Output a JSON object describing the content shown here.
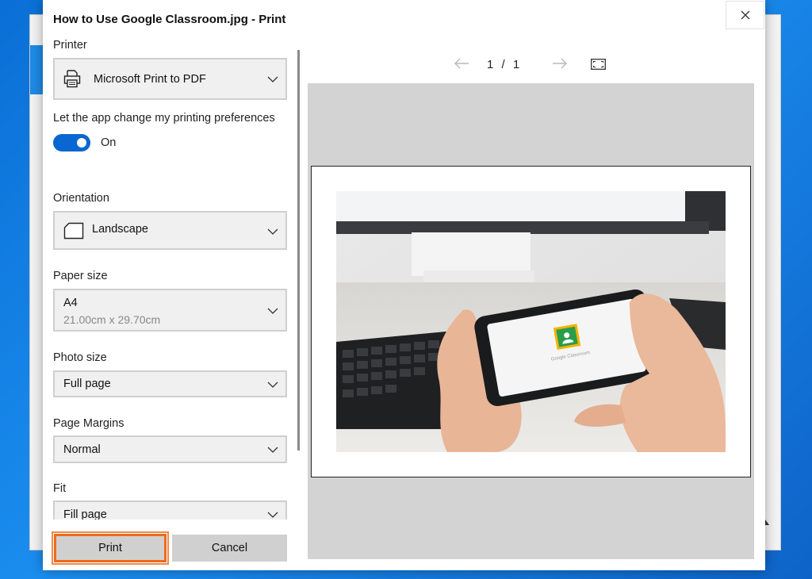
{
  "dialog": {
    "title": "How to Use Google Classroom.jpg - Print",
    "close_icon": "close-icon"
  },
  "printer": {
    "label": "Printer",
    "value": "Microsoft Print to PDF",
    "icon": "printer-icon"
  },
  "preferences": {
    "label": "Let the app change my printing preferences",
    "state": "On",
    "enabled": true
  },
  "orientation": {
    "label": "Orientation",
    "value": "Landscape",
    "icon": "page-landscape-icon"
  },
  "paper_size": {
    "label": "Paper size",
    "value": "A4",
    "detail": "21.00cm x 29.70cm"
  },
  "photo_size": {
    "label": "Photo size",
    "value": "Full page"
  },
  "page_margins": {
    "label": "Page Margins",
    "value": "Normal"
  },
  "fit": {
    "label": "Fit",
    "value": "Fill page"
  },
  "buttons": {
    "print": "Print",
    "cancel": "Cancel"
  },
  "preview": {
    "current_page": "1",
    "separator": "/",
    "total_pages": "1",
    "page_text": "1 / 1",
    "screen_text": "Google Classroom"
  },
  "colors": {
    "accent": "#0a66d1",
    "highlight": "#ee6a1e",
    "desktop": "#1b8ef0"
  }
}
